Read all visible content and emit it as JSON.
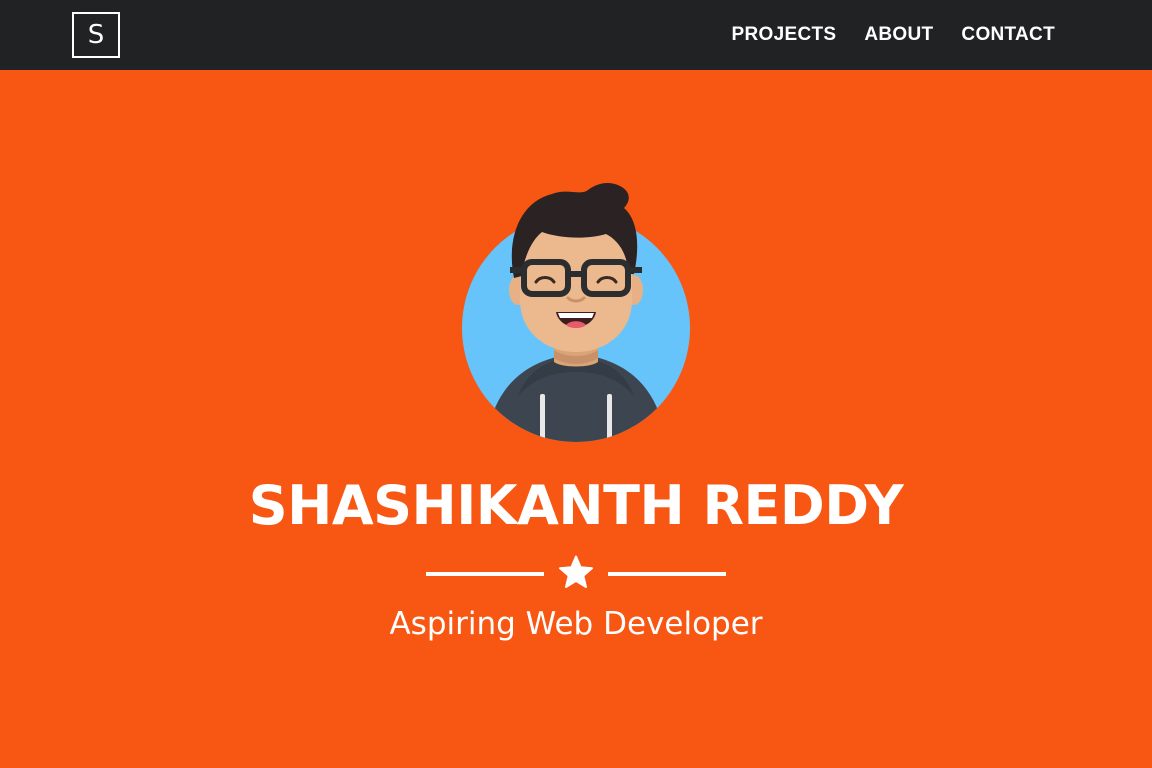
{
  "navbar": {
    "brand": "S",
    "links": [
      {
        "label": "PROJECTS"
      },
      {
        "label": "ABOUT"
      },
      {
        "label": "CONTACT"
      }
    ]
  },
  "hero": {
    "name": "SHASHIKANTH REDDY",
    "subtitle": "Aspiring Web Developer",
    "divider_icon": "star-icon",
    "avatar_icon": "avatar-illustration"
  },
  "colors": {
    "navbar_bg": "#212224",
    "hero_bg": "#f75712",
    "text": "#ffffff",
    "avatar_circle": "#66c4fb"
  }
}
